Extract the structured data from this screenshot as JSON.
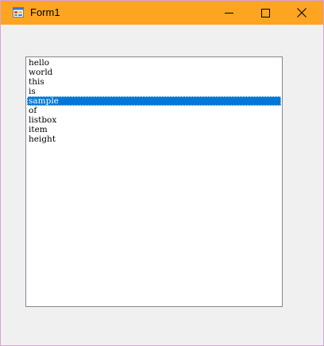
{
  "window": {
    "title": "Form1",
    "titlebar_color": "#fda421",
    "icons": {
      "app": "winforms-app-icon",
      "minimize": "minimize-icon",
      "maximize": "maximize-icon",
      "close": "close-icon"
    }
  },
  "listbox": {
    "selected_index": 4,
    "selection_color": "#0078d7",
    "items": [
      {
        "label": "hello"
      },
      {
        "label": "world"
      },
      {
        "label": "this"
      },
      {
        "label": "is"
      },
      {
        "label": "sample"
      },
      {
        "label": "of"
      },
      {
        "label": "listbox"
      },
      {
        "label": "item"
      },
      {
        "label": "height"
      }
    ]
  }
}
